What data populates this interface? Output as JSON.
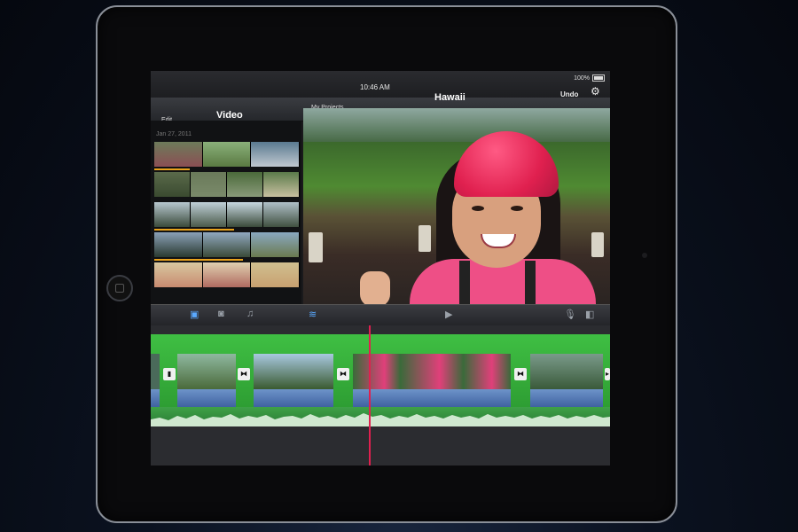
{
  "status": {
    "device": "iPad",
    "time": "10:46 AM",
    "battery": "100%"
  },
  "nav": {
    "edit": "Edit",
    "video_title": "Video",
    "projects": "My Projects",
    "project_title": "Hawaii",
    "undo": "Undo"
  },
  "browser": {
    "date": "Jan 27, 2011"
  },
  "icons": {
    "settings": "gear-icon",
    "video_tab": "video-icon",
    "photo_tab": "camera-icon",
    "music_tab": "music-note-icon",
    "play": "play-icon",
    "mic": "microphone-icon",
    "camera": "record-camera-icon"
  },
  "colors": {
    "accent": "#5aa9ff",
    "playhead": "#e0204f",
    "timeline_green": "#3fbf43",
    "audio_blue": "#4f74b3",
    "clip_bar": "#e8a21c"
  }
}
